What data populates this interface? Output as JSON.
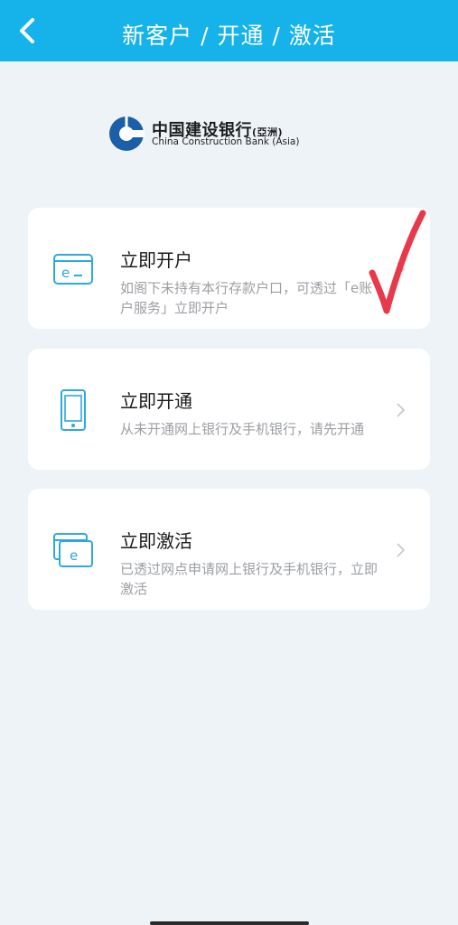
{
  "header": {
    "title": "新客户 / 开通 / 激活",
    "background": "#15b3ea"
  },
  "logo": {
    "name_cn": "中国建设银行",
    "name_cn_suffix": "(亞洲)",
    "name_en": "China Construction Bank (Asia)",
    "brand_color": "#1a5fa8"
  },
  "options": [
    {
      "title": "立即开户",
      "desc": "如阁下未持有本行存款户口，可透过「e账户服务」立即开户",
      "icon": "e-card-icon"
    },
    {
      "title": "立即开通",
      "desc": "从未开通网上银行及手机银行，请先开通",
      "icon": "mobile-phone-icon"
    },
    {
      "title": "立即激活",
      "desc": "已透过网点申请网上银行及手机银行，立即激活",
      "icon": "stacked-cards-icon"
    }
  ],
  "annotation": {
    "type": "hand-drawn checkmark",
    "color": "#e8394a"
  },
  "colors": {
    "accent": "#15b3ea",
    "icon": "#2ea8e0",
    "background": "#eef3f8",
    "card": "#ffffff",
    "secondary_text": "#9b9ea3"
  }
}
